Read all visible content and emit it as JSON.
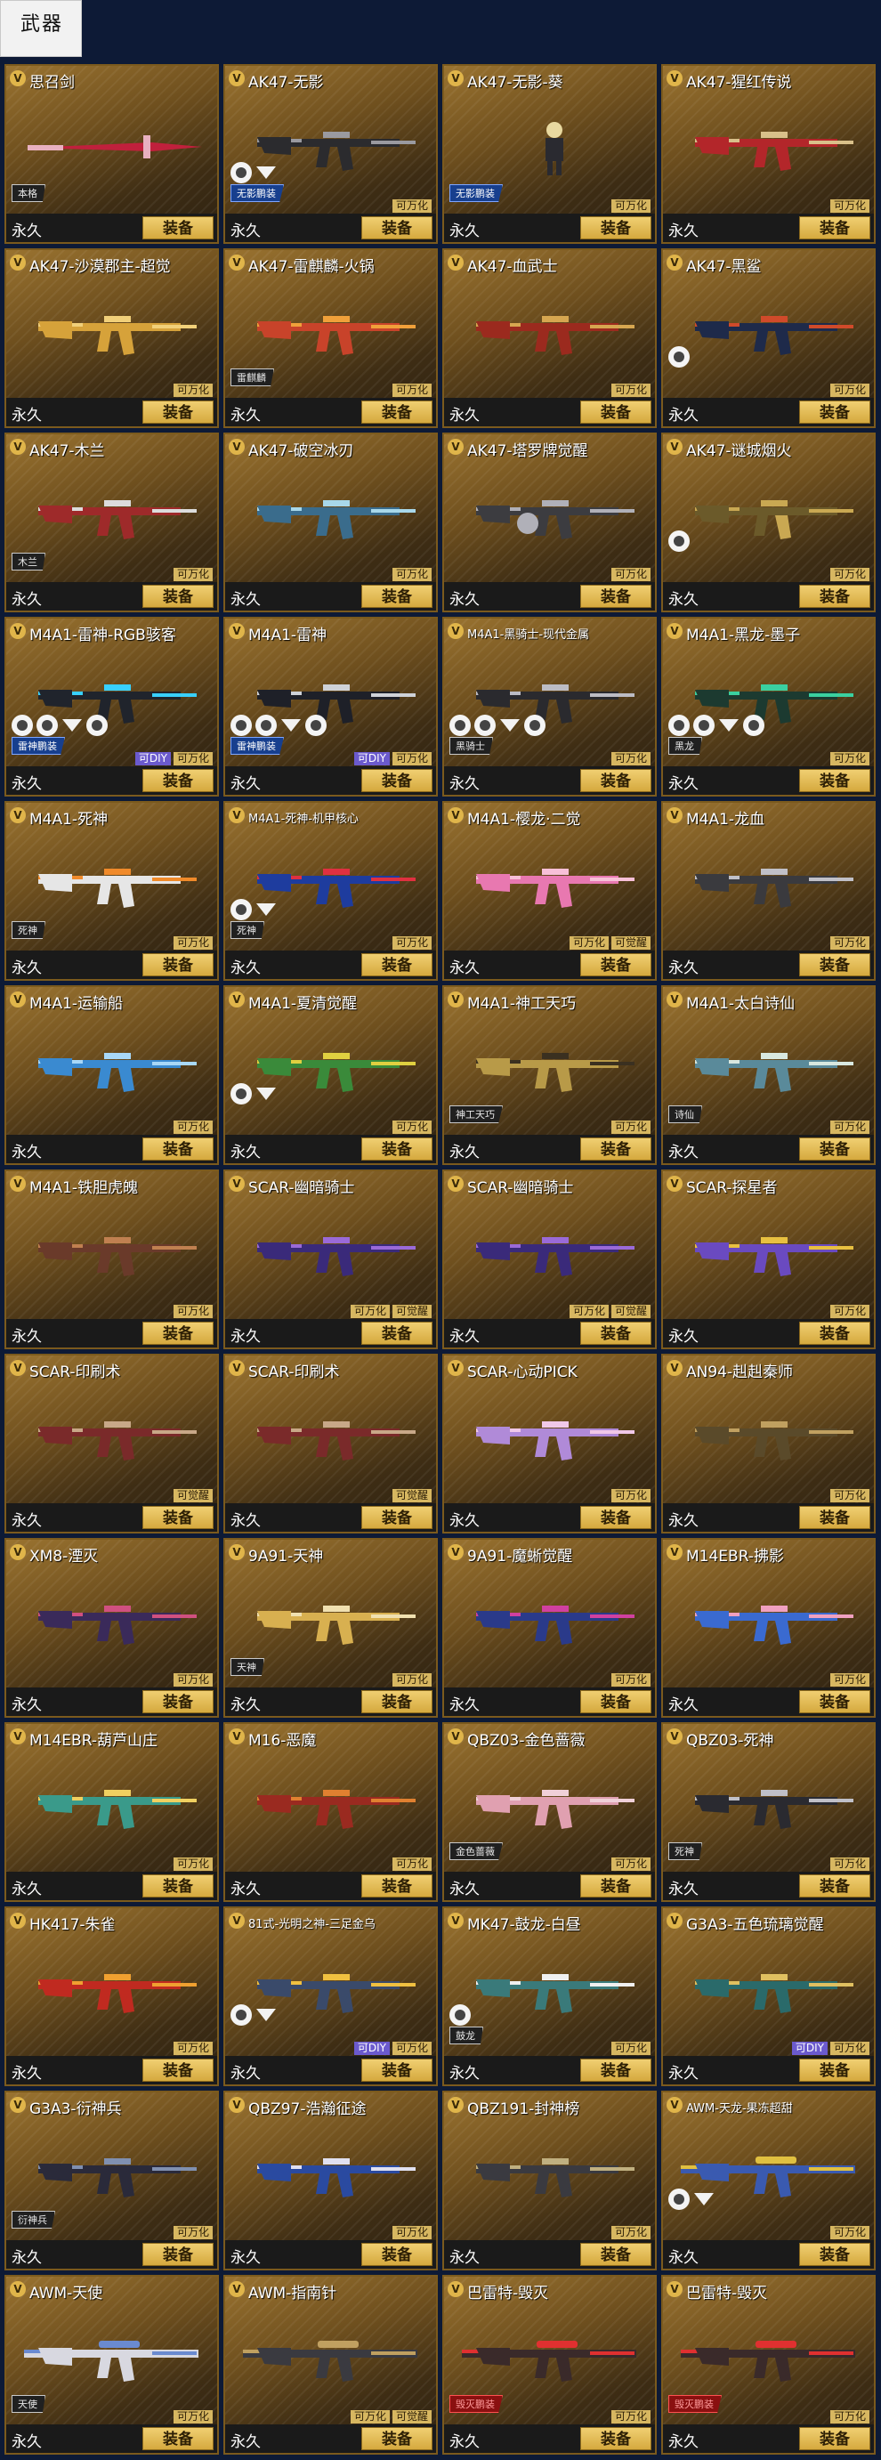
{
  "page": {
    "title": "武器"
  },
  "labels": {
    "equip": "装备",
    "duration": "永久",
    "v_badge": "V"
  },
  "colors": {
    "accent": "#d5a93e",
    "background": "#0d1a36",
    "diy": "#6b5acd"
  },
  "weapons": [
    {
      "name": "思召剑",
      "tags": [],
      "skin_label": "本格",
      "emblems": [],
      "gun": "sword",
      "palette": [
        "#c0203c",
        "#e8b0c0"
      ]
    },
    {
      "name": "AK47-无影",
      "tags": [
        "可万化"
      ],
      "skin_label": "无影鹏装",
      "skin_style": "blue",
      "emblems": [
        "circle",
        "eagle"
      ],
      "gun": "rifle",
      "palette": [
        "#2b2b2e",
        "#9a9aa0"
      ]
    },
    {
      "name": "AK47-无影-葵",
      "tags": [
        "可万化"
      ],
      "skin_label": "无影鹏装",
      "skin_style": "blue",
      "emblems": [],
      "gun": "figure",
      "palette": [
        "#2a2a30",
        "#e9d9a0"
      ]
    },
    {
      "name": "AK47-猩红传说",
      "tags": [
        "可万化"
      ],
      "skin_label": "",
      "emblems": [],
      "gun": "rifle",
      "palette": [
        "#b3262a",
        "#d9c08a"
      ]
    },
    {
      "name": "AK47-沙漠郡主-超觉",
      "tags": [
        "可万化"
      ],
      "skin_label": "",
      "emblems": [],
      "gun": "rifle",
      "palette": [
        "#d6a23a",
        "#f1d07a"
      ]
    },
    {
      "name": "AK47-雷麒麟-火锅",
      "tags": [
        "可万化"
      ],
      "skin_label": "雷麒麟",
      "emblems": [],
      "gun": "rifle",
      "palette": [
        "#c8432a",
        "#f0a03a"
      ]
    },
    {
      "name": "AK47-血武士",
      "tags": [
        "可万化"
      ],
      "skin_label": "",
      "emblems": [],
      "gun": "rifle",
      "palette": [
        "#9b2a1e",
        "#d6a650"
      ]
    },
    {
      "name": "AK47-黑鲨",
      "tags": [
        "可万化"
      ],
      "skin_label": "",
      "emblems": [
        "circle"
      ],
      "gun": "rifle",
      "palette": [
        "#1e2a4a",
        "#d04a2a"
      ]
    },
    {
      "name": "AK47-木兰",
      "tags": [
        "可万化"
      ],
      "skin_label": "木兰",
      "emblems": [],
      "gun": "rifle",
      "palette": [
        "#9e2a2a",
        "#dcdcdc"
      ]
    },
    {
      "name": "AK47-破空冰刃",
      "tags": [
        "可万化"
      ],
      "skin_label": "",
      "emblems": [],
      "gun": "rifle",
      "palette": [
        "#3a6c8c",
        "#a8d8ea"
      ]
    },
    {
      "name": "AK47-塔罗牌觉醒",
      "tags": [
        "可万化"
      ],
      "skin_label": "",
      "emblems": [],
      "gun": "heavy",
      "palette": [
        "#3c3c40",
        "#b0b0b8"
      ]
    },
    {
      "name": "AK47-谜城烟火",
      "tags": [
        "可万化"
      ],
      "skin_label": "",
      "emblems": [
        "circle"
      ],
      "gun": "curved",
      "palette": [
        "#6b5a2a",
        "#c9a852"
      ]
    },
    {
      "name": "M4A1-雷神-RGB骇客",
      "tags": [
        "可DIY",
        "可万化"
      ],
      "skin_label": "雷神鹏装",
      "skin_style": "blue",
      "emblems": [
        "circle",
        "circle",
        "eagle",
        "circle"
      ],
      "gun": "rifle",
      "palette": [
        "#20242c",
        "#38d0ff"
      ]
    },
    {
      "name": "M4A1-雷神",
      "tags": [
        "可DIY",
        "可万化"
      ],
      "skin_label": "雷神鹏装",
      "skin_style": "blue",
      "emblems": [
        "circle",
        "circle",
        "eagle",
        "circle"
      ],
      "gun": "rifle",
      "palette": [
        "#1e2028",
        "#cfd2d8"
      ]
    },
    {
      "name": "M4A1-黑骑士-现代金属",
      "tags": [
        "可万化"
      ],
      "skin_label": "黑骑士",
      "emblems": [
        "circle",
        "circle",
        "eagle",
        "circle"
      ],
      "gun": "rifle",
      "palette": [
        "#2a2a2e",
        "#bcbcc4"
      ],
      "small": true
    },
    {
      "name": "M4A1-黑龙-墨子",
      "tags": [
        "可万化"
      ],
      "skin_label": "黑龙",
      "emblems": [
        "circle",
        "circle",
        "eagle",
        "circle"
      ],
      "gun": "rifle",
      "palette": [
        "#1c3a30",
        "#3ad0a0"
      ]
    },
    {
      "name": "M4A1-死神",
      "tags": [
        "可万化"
      ],
      "skin_label": "死神",
      "emblems": [],
      "gun": "rifle",
      "palette": [
        "#e6e6e6",
        "#f08a2a"
      ]
    },
    {
      "name": "M4A1-死神-机甲核心",
      "tags": [
        "可万化"
      ],
      "skin_label": "死神",
      "emblems": [
        "circle",
        "eagle"
      ],
      "gun": "rifle",
      "palette": [
        "#1e3c9e",
        "#e03040"
      ],
      "small": true
    },
    {
      "name": "M4A1-樱龙·二觉",
      "tags": [
        "可万化",
        "可觉醒"
      ],
      "skin_label": "",
      "emblems": [],
      "gun": "rifle",
      "palette": [
        "#e878b0",
        "#f8c0d8"
      ]
    },
    {
      "name": "M4A1-龙血",
      "tags": [
        "可万化"
      ],
      "skin_label": "",
      "emblems": [],
      "gun": "rifle",
      "palette": [
        "#3a3a3e",
        "#c0c0c8"
      ]
    },
    {
      "name": "M4A1-运输船",
      "tags": [
        "可万化"
      ],
      "skin_label": "",
      "emblems": [],
      "gun": "rifle",
      "palette": [
        "#3a8ad0",
        "#a8d8f8"
      ]
    },
    {
      "name": "M4A1-夏清觉醒",
      "tags": [
        "可万化"
      ],
      "skin_label": "",
      "emblems": [
        "circle",
        "eagle"
      ],
      "gun": "rifle",
      "palette": [
        "#3a8a3a",
        "#e0d040"
      ]
    },
    {
      "name": "M4A1-神工天巧",
      "tags": [
        "可万化"
      ],
      "skin_label": "神工天巧",
      "emblems": [],
      "gun": "rifle",
      "palette": [
        "#b89a48",
        "#3a3020"
      ]
    },
    {
      "name": "M4A1-太白诗仙",
      "tags": [
        "可万化"
      ],
      "skin_label": "诗仙",
      "emblems": [],
      "gun": "rifle",
      "palette": [
        "#5a8a9a",
        "#d8e8e0"
      ]
    },
    {
      "name": "M4A1-铁胆虎魄",
      "tags": [
        "可万化"
      ],
      "skin_label": "",
      "emblems": [],
      "gun": "rifle",
      "palette": [
        "#6a3a2a",
        "#c08050"
      ]
    },
    {
      "name": "SCAR-幽暗骑士",
      "tags": [
        "可万化",
        "可觉醒"
      ],
      "skin_label": "",
      "emblems": [],
      "gun": "rifle",
      "palette": [
        "#3a2a7a",
        "#9a6ad8"
      ]
    },
    {
      "name": "SCAR-幽暗骑士",
      "tags": [
        "可万化",
        "可觉醒"
      ],
      "skin_label": "",
      "emblems": [],
      "gun": "rifle",
      "palette": [
        "#3a2a7a",
        "#9a6ad8"
      ]
    },
    {
      "name": "SCAR-探星者",
      "tags": [
        "可万化"
      ],
      "skin_label": "",
      "emblems": [],
      "gun": "rifle",
      "palette": [
        "#6a4ac0",
        "#e8c040"
      ]
    },
    {
      "name": "SCAR-印刷术",
      "tags": [
        "可觉醒"
      ],
      "skin_label": "",
      "emblems": [],
      "gun": "rifle",
      "palette": [
        "#7a2a2a",
        "#c8a888"
      ]
    },
    {
      "name": "SCAR-印刷术",
      "tags": [
        "可觉醒"
      ],
      "skin_label": "",
      "emblems": [],
      "gun": "rifle",
      "palette": [
        "#7a2a2a",
        "#c8a888"
      ]
    },
    {
      "name": "SCAR-心动PICK",
      "tags": [
        "可万化"
      ],
      "skin_label": "",
      "emblems": [],
      "gun": "rifle",
      "palette": [
        "#b08ad8",
        "#f0c8e8"
      ]
    },
    {
      "name": "AN94-赳赳秦师",
      "tags": [
        "可万化"
      ],
      "skin_label": "",
      "emblems": [],
      "gun": "rifle",
      "palette": [
        "#5a4a2a",
        "#c0a060"
      ]
    },
    {
      "name": "XM8-湮灭",
      "tags": [
        "可万化"
      ],
      "skin_label": "",
      "emblems": [],
      "gun": "rifle",
      "palette": [
        "#3a2a5a",
        "#d05080"
      ]
    },
    {
      "name": "9A91-天神",
      "tags": [
        "可万化"
      ],
      "skin_label": "天神",
      "emblems": [],
      "gun": "smg",
      "palette": [
        "#d8b050",
        "#f0e0b0"
      ]
    },
    {
      "name": "9A91-魔蜥觉醒",
      "tags": [
        "可万化"
      ],
      "skin_label": "",
      "emblems": [],
      "gun": "smg",
      "palette": [
        "#2a3a8a",
        "#d040a0"
      ]
    },
    {
      "name": "M14EBR-拂影",
      "tags": [
        "可万化"
      ],
      "skin_label": "",
      "emblems": [],
      "gun": "rifle",
      "palette": [
        "#3a6ad0",
        "#f0a0c0"
      ]
    },
    {
      "name": "M14EBR-葫芦山庄",
      "tags": [
        "可万化"
      ],
      "skin_label": "",
      "emblems": [],
      "gun": "rifle",
      "palette": [
        "#3a9a8a",
        "#f0d060"
      ]
    },
    {
      "name": "M16-恶魔",
      "tags": [
        "可万化"
      ],
      "skin_label": "",
      "emblems": [],
      "gun": "rifle",
      "palette": [
        "#9a2a20",
        "#e08030"
      ]
    },
    {
      "name": "QBZ03-金色蔷薇",
      "tags": [
        "可万化"
      ],
      "skin_label": "金色蔷薇",
      "emblems": [],
      "gun": "rifle",
      "palette": [
        "#e0a0b0",
        "#f0d0d8"
      ]
    },
    {
      "name": "QBZ03-死神",
      "tags": [
        "可万化"
      ],
      "skin_label": "死神",
      "emblems": [],
      "gun": "rifle",
      "palette": [
        "#2a2a30",
        "#c0c0c8"
      ]
    },
    {
      "name": "HK417-朱雀",
      "tags": [
        "可万化"
      ],
      "skin_label": "",
      "emblems": [],
      "gun": "rifle",
      "palette": [
        "#c02a20",
        "#f0a030"
      ]
    },
    {
      "name": "81式-光明之神-三足金乌",
      "tags": [
        "可DIY",
        "可万化"
      ],
      "skin_label": "",
      "emblems": [
        "circle",
        "eagle"
      ],
      "gun": "rifle",
      "palette": [
        "#3a4a6a",
        "#f0c040"
      ],
      "small": true
    },
    {
      "name": "MK47-鼓龙-白昼",
      "tags": [
        "可万化"
      ],
      "skin_label": "鼓龙",
      "emblems": [
        "circle"
      ],
      "gun": "rifle",
      "palette": [
        "#3a7a7a",
        "#f0f0f0"
      ]
    },
    {
      "name": "G3A3-五色琉璃觉醒",
      "tags": [
        "可DIY",
        "可万化"
      ],
      "skin_label": "",
      "emblems": [],
      "gun": "rifle",
      "palette": [
        "#2a6a6a",
        "#e0c060"
      ]
    },
    {
      "name": "G3A3-衍神兵",
      "tags": [
        "可万化"
      ],
      "skin_label": "衍神兵",
      "emblems": [],
      "gun": "rifle",
      "palette": [
        "#2a2a3a",
        "#8090b0"
      ]
    },
    {
      "name": "QBZ97-浩瀚征途",
      "tags": [
        "可万化"
      ],
      "skin_label": "",
      "emblems": [],
      "gun": "rifle",
      "palette": [
        "#2a4aa0",
        "#e0e0f0"
      ]
    },
    {
      "name": "QBZ191-封神榜",
      "tags": [
        "可万化"
      ],
      "skin_label": "",
      "emblems": [],
      "gun": "rifle",
      "palette": [
        "#3a3a40",
        "#c0b080"
      ]
    },
    {
      "name": "AWM-天龙-果冻超甜",
      "tags": [
        "可万化"
      ],
      "skin_label": "",
      "emblems": [
        "circle",
        "eagle"
      ],
      "gun": "sniper",
      "palette": [
        "#3a5ab0",
        "#e0c040"
      ],
      "small": true
    },
    {
      "name": "AWM-天使",
      "tags": [
        "可万化"
      ],
      "skin_label": "天使",
      "emblems": [],
      "gun": "sniper",
      "palette": [
        "#d8d8e0",
        "#6a8ad0"
      ]
    },
    {
      "name": "AWM-指南针",
      "tags": [
        "可万化",
        "可觉醒"
      ],
      "skin_label": "",
      "emblems": [],
      "gun": "sniper",
      "palette": [
        "#3a3a40",
        "#c0a060"
      ]
    },
    {
      "name": "巴雷特-毁灭",
      "tags": [
        "可万化"
      ],
      "skin_label": "毁灭鹏装",
      "skin_style": "red",
      "emblems": [],
      "gun": "sniper",
      "palette": [
        "#3a2a2a",
        "#e03030"
      ]
    },
    {
      "name": "巴雷特-毁灭",
      "tags": [
        "可万化"
      ],
      "skin_label": "毁灭鹏装",
      "skin_style": "red",
      "emblems": [],
      "gun": "sniper",
      "palette": [
        "#3a2a2a",
        "#e03030"
      ]
    }
  ]
}
